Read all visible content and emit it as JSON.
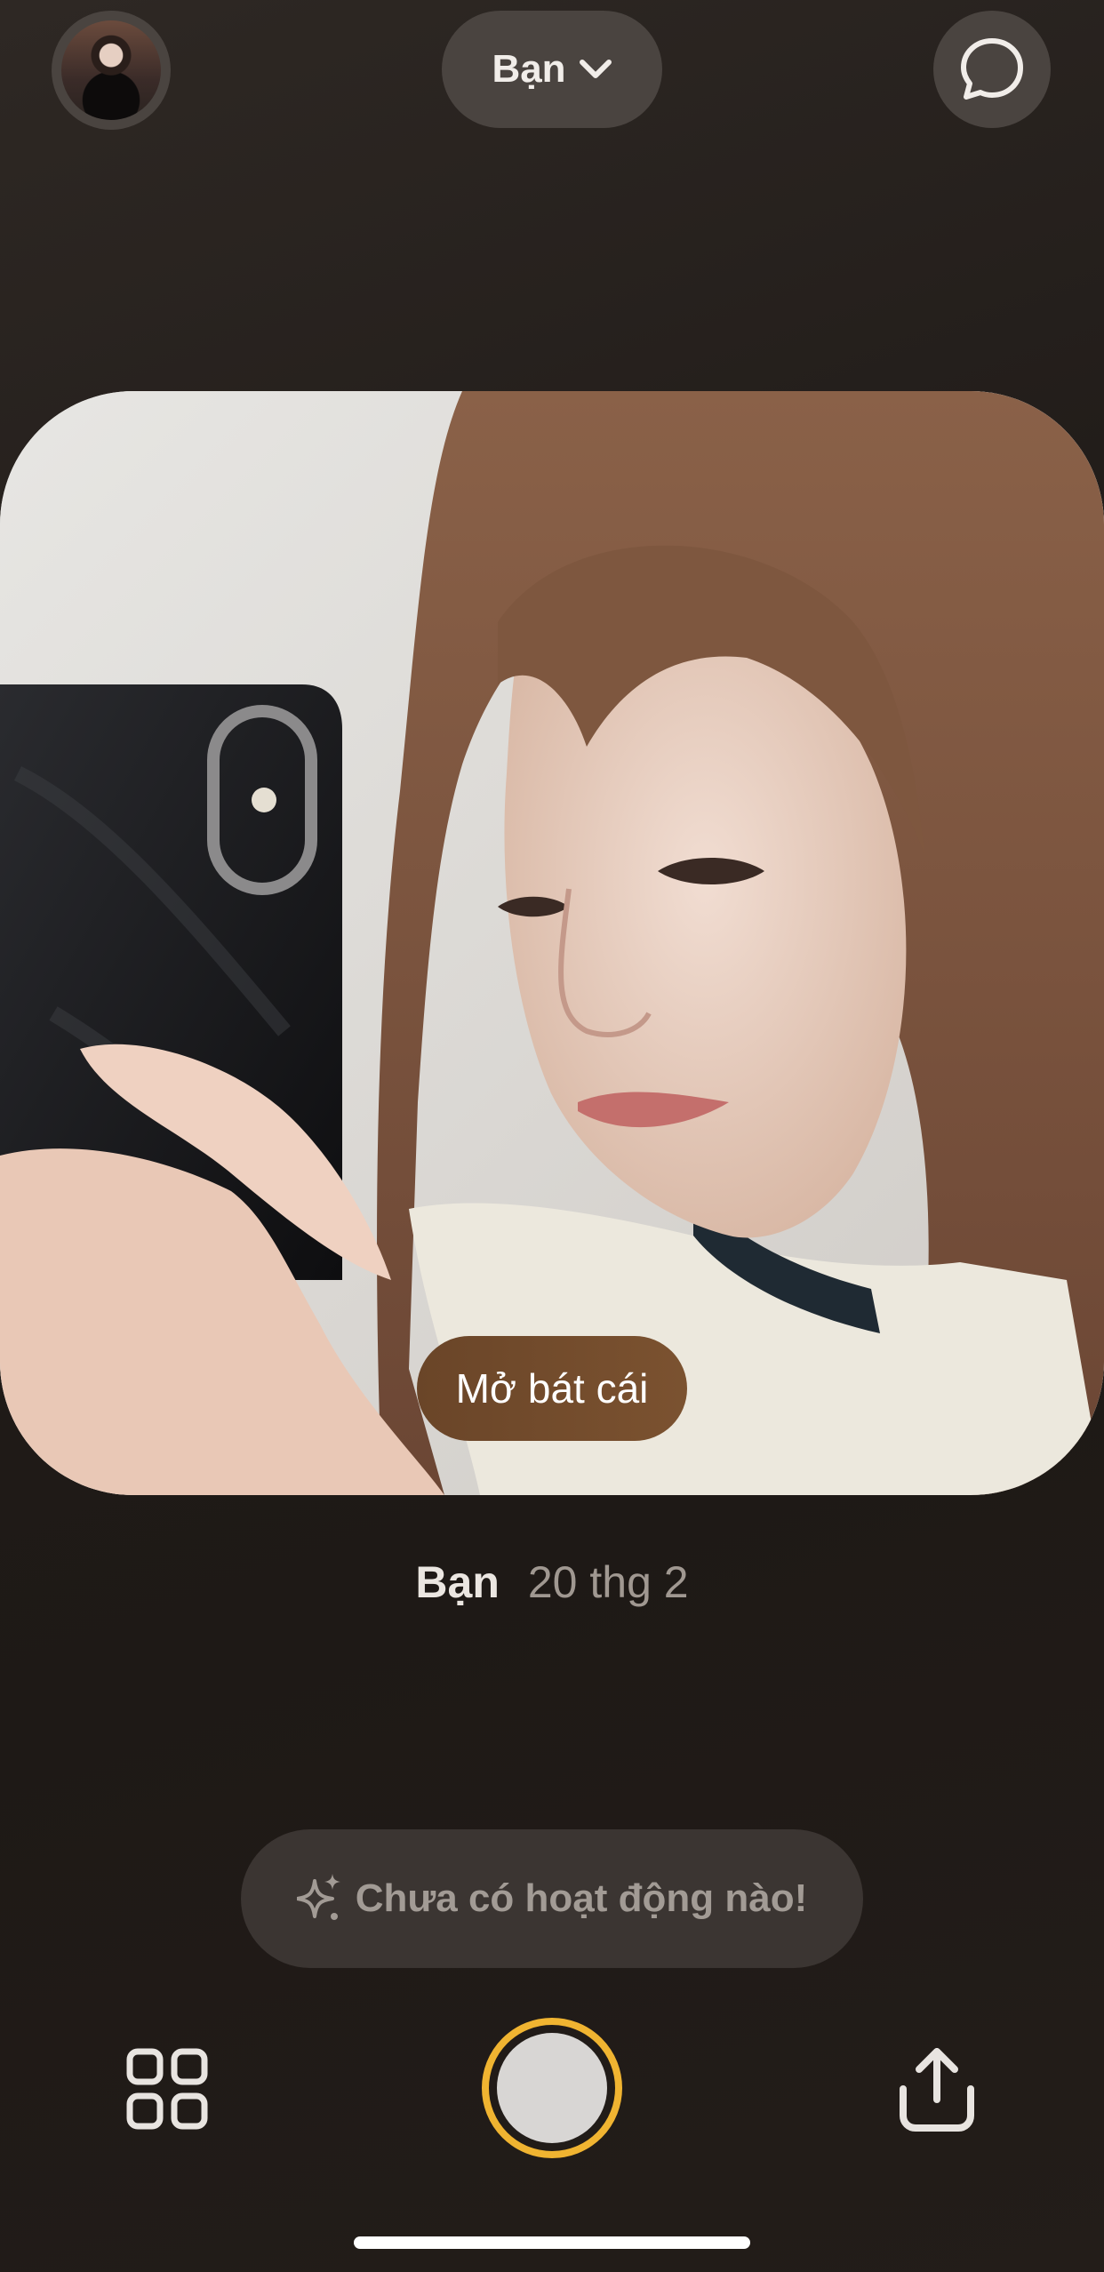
{
  "header": {
    "avatar_icon": "profile-avatar",
    "audience_label": "Bạn",
    "audience_icon": "chevron-down-icon",
    "chat_icon": "chat-bubble-icon"
  },
  "post": {
    "caption": "Mở bát cái",
    "author": "Bạn",
    "date": "20 thg 2"
  },
  "activity": {
    "icon": "sparkles-icon",
    "text": "Chưa có hoạt động nào!"
  },
  "controls": {
    "grid_icon": "grid-icon",
    "shutter_icon": "shutter-button",
    "share_icon": "share-icon",
    "accent_color": "#f0b431"
  }
}
